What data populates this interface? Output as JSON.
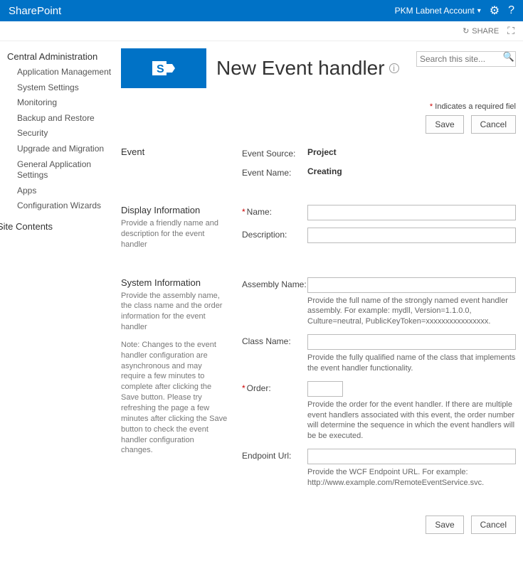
{
  "suite": {
    "brand": "SharePoint",
    "account": "PKM Labnet Account"
  },
  "ribbon": {
    "share": "SHARE"
  },
  "search": {
    "placeholder": "Search this site..."
  },
  "page": {
    "title": "New Event handler",
    "required_note": "Indicates a required fiel"
  },
  "nav": {
    "heading1": "Central Administration",
    "items": [
      "Application Management",
      "System Settings",
      "Monitoring",
      "Backup and Restore",
      "Security",
      "Upgrade and Migration",
      "General Application Settings",
      "Apps",
      "Configuration Wizards"
    ],
    "heading2": "Site Contents"
  },
  "sections": {
    "event": {
      "title": "Event",
      "source_label": "Event Source:",
      "source_value": "Project",
      "name_label": "Event Name:",
      "name_value": "Creating"
    },
    "display": {
      "title": "Display Information",
      "desc": "Provide a friendly name and description for the event handler",
      "name_label": "Name:",
      "desc_label": "Description:"
    },
    "system": {
      "title": "System Information",
      "desc": "Provide the assembly name, the class name and the order information for the event handler",
      "note": "Note: Changes to the event handler configuration are asynchronous and may require a few minutes to complete after clicking the Save button. Please try refreshing the page a few minutes after clicking the Save button to check the event handler configuration changes.",
      "assembly_label": "Assembly Name:",
      "assembly_hint": "Provide the full name of the strongly named event handler assembly. For example: mydll, Version=1.1.0.0, Culture=neutral, PublicKeyToken=xxxxxxxxxxxxxxxx.",
      "class_label": "Class Name:",
      "class_hint": "Provide the fully qualified name of the class that implements the event handler functionality.",
      "order_label": "Order:",
      "order_hint": "Provide the order for the event handler. If there are multiple event handlers associated with this event, the order number will determine the sequence in which the event handlers will be be executed.",
      "endpoint_label": "Endpoint Url:",
      "endpoint_hint": "Provide the WCF Endpoint URL. For example: http://www.example.com/RemoteEventService.svc."
    }
  },
  "buttons": {
    "save": "Save",
    "cancel": "Cancel"
  }
}
